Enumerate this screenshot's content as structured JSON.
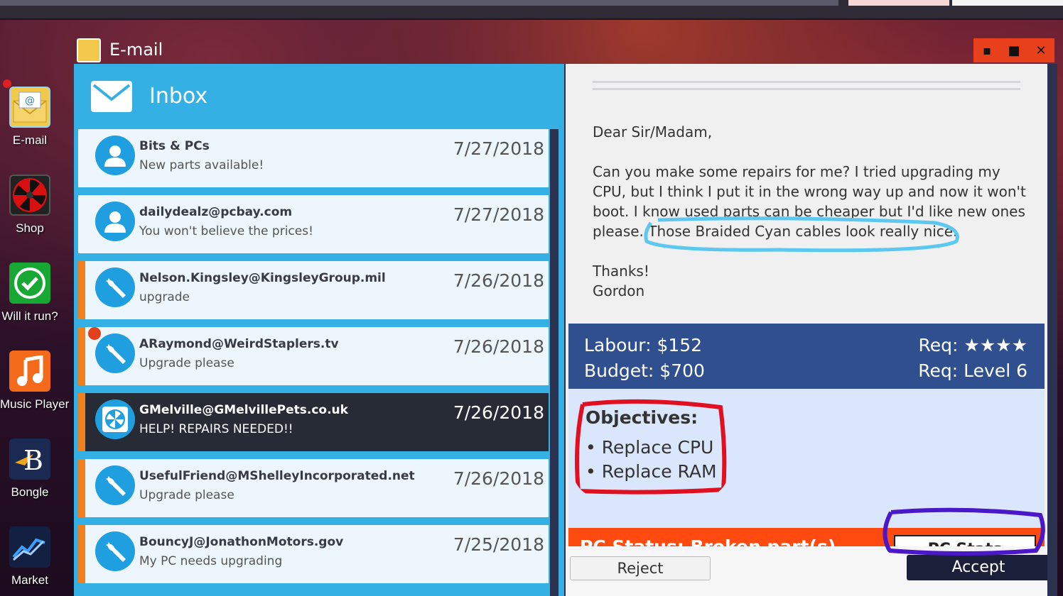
{
  "desktop": {
    "icons": [
      {
        "label": "E-mail",
        "icon": "email-icon"
      },
      {
        "label": "Shop",
        "icon": "fan-icon"
      },
      {
        "label": "Will it run?",
        "icon": "check-icon"
      },
      {
        "label": "Music Player",
        "icon": "music-note-icon"
      },
      {
        "label": "Bongle",
        "icon": "bongle-logo-icon"
      },
      {
        "label": "Market",
        "icon": "chart-icon"
      }
    ]
  },
  "window": {
    "title": "E-mail",
    "controls": {
      "minimize": "▪",
      "maximize": "■",
      "close": "✕"
    }
  },
  "inbox": {
    "title": "Inbox",
    "items": [
      {
        "from": "Bits & PCs",
        "subject": "New parts available!",
        "date": "7/27/2018",
        "icon": "user-icon"
      },
      {
        "from": "dailydealz@pcbay.com",
        "subject": "You won't believe the prices!",
        "date": "7/27/2018",
        "icon": "user-icon"
      },
      {
        "from": "Nelson.Kingsley@KingsleyGroup.mil",
        "subject": "upgrade",
        "date": "7/26/2018",
        "icon": "wrench-icon"
      },
      {
        "from": "ARaymond@WeirdStaplers.tv",
        "subject": "Upgrade please",
        "date": "7/26/2018",
        "icon": "wrench-icon"
      },
      {
        "from": "GMelville@GMelvillePets.co.uk",
        "subject": "HELP! REPAIRS NEEDED!!",
        "date": "7/26/2018",
        "icon": "fan-icon"
      },
      {
        "from": "UsefulFriend@MShelleyIncorporated.net",
        "subject": "Upgrade please",
        "date": "7/26/2018",
        "icon": "wrench-icon"
      },
      {
        "from": "BouncyJ@JonathonMotors.gov",
        "subject": "My PC needs upgrading",
        "date": "7/25/2018",
        "icon": "wrench-icon"
      }
    ]
  },
  "message": {
    "greeting": "Dear Sir/Madam,",
    "body": "Can you make some repairs for me? I tried upgrading my CPU, but I think I put it in the wrong way up and now it won't boot. I know used parts can be cheaper but I'd like new ones please. Those Braided Cyan cables look really nice.",
    "signoff": "Thanks!",
    "signature": "Gordon"
  },
  "job": {
    "labour": "Labour: $152",
    "budget": "Budget: $700",
    "req_stars": "Req: ★★★★",
    "req_level": "Req: Level 6",
    "objectives_title": "Objectives:",
    "objectives": [
      "• Replace CPU",
      "• Replace RAM"
    ],
    "status": "PC Status: Broken part(s)",
    "pc_stats_label": "PC Stats"
  },
  "actions": {
    "reject": "Reject",
    "accept": "Accept"
  },
  "colors": {
    "inbox_blue": "#35b0e4",
    "info_band": "#2f4f8e",
    "status_orange": "#ff4a10",
    "accept_dark": "#1b1f3a",
    "task_stripe": "#f0801e"
  }
}
